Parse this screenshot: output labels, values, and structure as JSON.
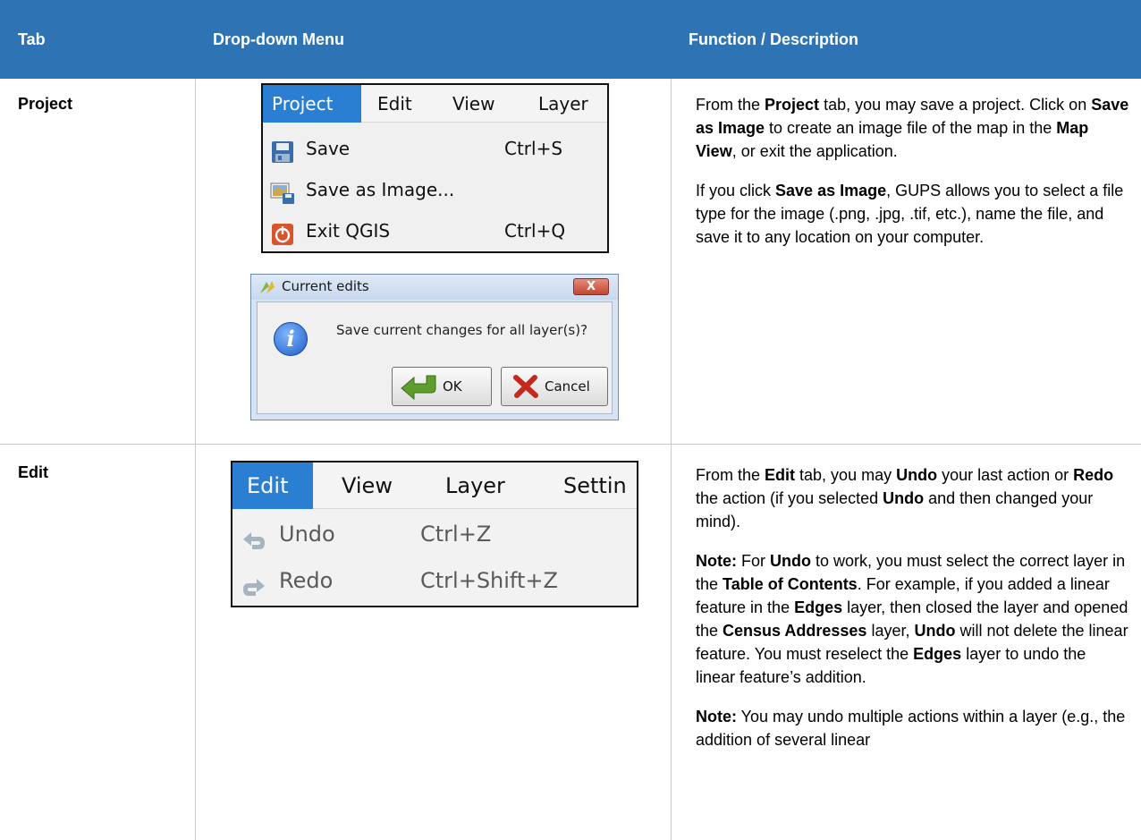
{
  "header": {
    "col1": "Tab",
    "col2": "Drop-down Menu",
    "col3": "Function / Description"
  },
  "rows": [
    {
      "tab": "Project",
      "menu": {
        "bar": [
          "Project",
          "Edit",
          "View",
          "Layer"
        ],
        "items": [
          {
            "icon": "save-icon",
            "label": "Save",
            "shortcut": "Ctrl+S"
          },
          {
            "icon": "save-as-image-icon",
            "label": "Save as Image...",
            "shortcut": ""
          },
          {
            "icon": "exit-icon",
            "label": "Exit QGIS",
            "shortcut": "Ctrl+Q"
          }
        ]
      },
      "dialog": {
        "title": "Current edits",
        "close_label": "X",
        "message": "Save current changes for all layer(s)?",
        "ok_label": "OK",
        "cancel_label": "Cancel"
      },
      "description": {
        "p1": [
          {
            "t": "From the ",
            "b": false
          },
          {
            "t": "Project",
            "b": true
          },
          {
            "t": " tab, you may save a project. Click on ",
            "b": false
          },
          {
            "t": "Save as Image",
            "b": true
          },
          {
            "t": " to create an image file of the map in the ",
            "b": false
          },
          {
            "t": "Map View",
            "b": true
          },
          {
            "t": ", or exit the application.",
            "b": false
          }
        ],
        "p2": [
          {
            "t": "If you click ",
            "b": false
          },
          {
            "t": "Save as Image",
            "b": true
          },
          {
            "t": ", GUPS allows you to select a file type for the image (.png, .jpg, .tif, etc.), name the file, and save it to any location on your computer.",
            "b": false
          }
        ]
      }
    },
    {
      "tab": "Edit",
      "menu": {
        "bar": [
          "Edit",
          "View",
          "Layer",
          "Settin"
        ],
        "items": [
          {
            "icon": "undo-icon",
            "label": "Undo",
            "shortcut": "Ctrl+Z"
          },
          {
            "icon": "redo-icon",
            "label": "Redo",
            "shortcut": "Ctrl+Shift+Z"
          }
        ]
      },
      "description": {
        "p1": [
          {
            "t": "From the ",
            "b": false
          },
          {
            "t": "Edit",
            "b": true
          },
          {
            "t": " tab, you may ",
            "b": false
          },
          {
            "t": "Undo",
            "b": true
          },
          {
            "t": " your last action or ",
            "b": false
          },
          {
            "t": "Redo",
            "b": true
          },
          {
            "t": " the action (if you selected ",
            "b": false
          },
          {
            "t": "Undo",
            "b": true
          },
          {
            "t": " and then changed your mind).",
            "b": false
          }
        ],
        "p2": [
          {
            "t": "Note:",
            "b": true
          },
          {
            "t": "  For ",
            "b": false
          },
          {
            "t": "Undo",
            "b": true
          },
          {
            "t": " to work, you must select the correct layer in the ",
            "b": false
          },
          {
            "t": "Table of Contents",
            "b": true
          },
          {
            "t": ". For example, if you added a linear feature in the ",
            "b": false
          },
          {
            "t": "Edges",
            "b": true
          },
          {
            "t": " layer, then closed the layer and opened the ",
            "b": false
          },
          {
            "t": "Census Addresses",
            "b": true
          },
          {
            "t": " layer, ",
            "b": false
          },
          {
            "t": "Undo",
            "b": true
          },
          {
            "t": " will not delete the linear feature. You must reselect the ",
            "b": false
          },
          {
            "t": "Edges",
            "b": true
          },
          {
            "t": " layer to undo the linear feature’s addition.",
            "b": false
          }
        ],
        "p3": [
          {
            "t": "Note:",
            "b": true
          },
          {
            "t": "  You may undo multiple actions within a layer (e.g., the addition of several linear",
            "b": false
          }
        ]
      }
    }
  ],
  "colors": {
    "header_bg": "#2e74b5",
    "grid": "#c8c8c8",
    "menu_highlight": "#2b7fd3"
  }
}
